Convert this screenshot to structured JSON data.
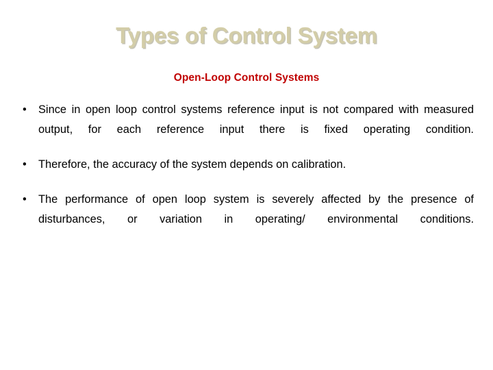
{
  "slide": {
    "background_color": "#ffffff",
    "title": "Types of Control System",
    "title_color": "#d3cda8",
    "subtitle": "Open-Loop Control Systems",
    "subtitle_color": "#c00000",
    "body_color": "#000000",
    "bullet_glyph": "•",
    "bullets": [
      {
        "text": "Since in open loop control systems reference input is not compared with measured output, for each reference input there is fixed operating condition.",
        "justify_last_line": false
      },
      {
        "text": "Therefore, the accuracy of the system depends on calibration.",
        "justify_last_line": false
      },
      {
        "text": "The performance of open loop system is severely affected by the presence of disturbances, or variation in operating/ environmental  conditions.",
        "justify_last_line": false
      }
    ]
  }
}
